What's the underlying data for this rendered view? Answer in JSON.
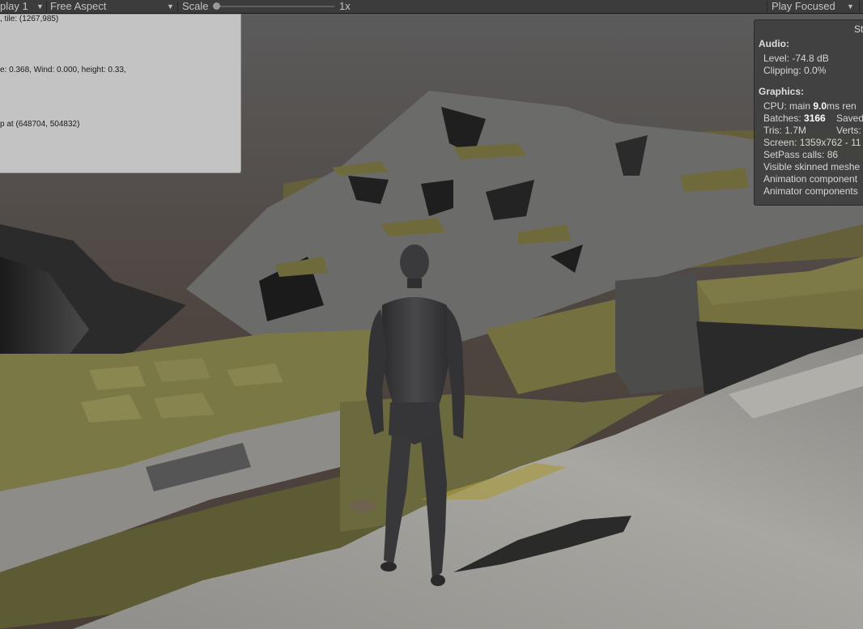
{
  "toolbar": {
    "display": "play 1",
    "aspect": "Free Aspect",
    "scale_label": "Scale",
    "scale_value": "1x",
    "play_mode": "Play Focused"
  },
  "debug": {
    "line1": ", tile: (1267,985)",
    "line2": "e: 0.368, Wind: 0.000, height: 0.33,",
    "line3": "p at (648704, 504832)"
  },
  "stats": {
    "title": "St",
    "audio_heading": "Audio:",
    "audio_level": "Level: -74.8 dB",
    "audio_clipping": "Clipping: 0.0%",
    "graphics_heading": "Graphics:",
    "cpu_prefix": "CPU: main ",
    "cpu_value": "9.0",
    "cpu_suffix": "ms  ren",
    "batches_prefix": "Batches: ",
    "batches_value": "3166",
    "batches_saved": "Saved",
    "tris": "Tris: 1.7M",
    "verts": "Verts:",
    "screen": "Screen: 1359x762 - 11",
    "setpass": "SetPass calls: 86",
    "visible_skinned": "Visible skinned meshe",
    "animation_components": "Animation component",
    "animator_components": "Animator components"
  },
  "colors": {
    "toolbar_bg": "#3c3c3c",
    "sky": "#4e4540",
    "grass": "#6f6a3c",
    "rock": "#8a8a88",
    "character": "#3a3a3c"
  },
  "icons": {
    "display_dropdown": "chevron-down-icon",
    "aspect_dropdown": "chevron-down-icon",
    "play_mode_dropdown": "chevron-down-icon"
  }
}
